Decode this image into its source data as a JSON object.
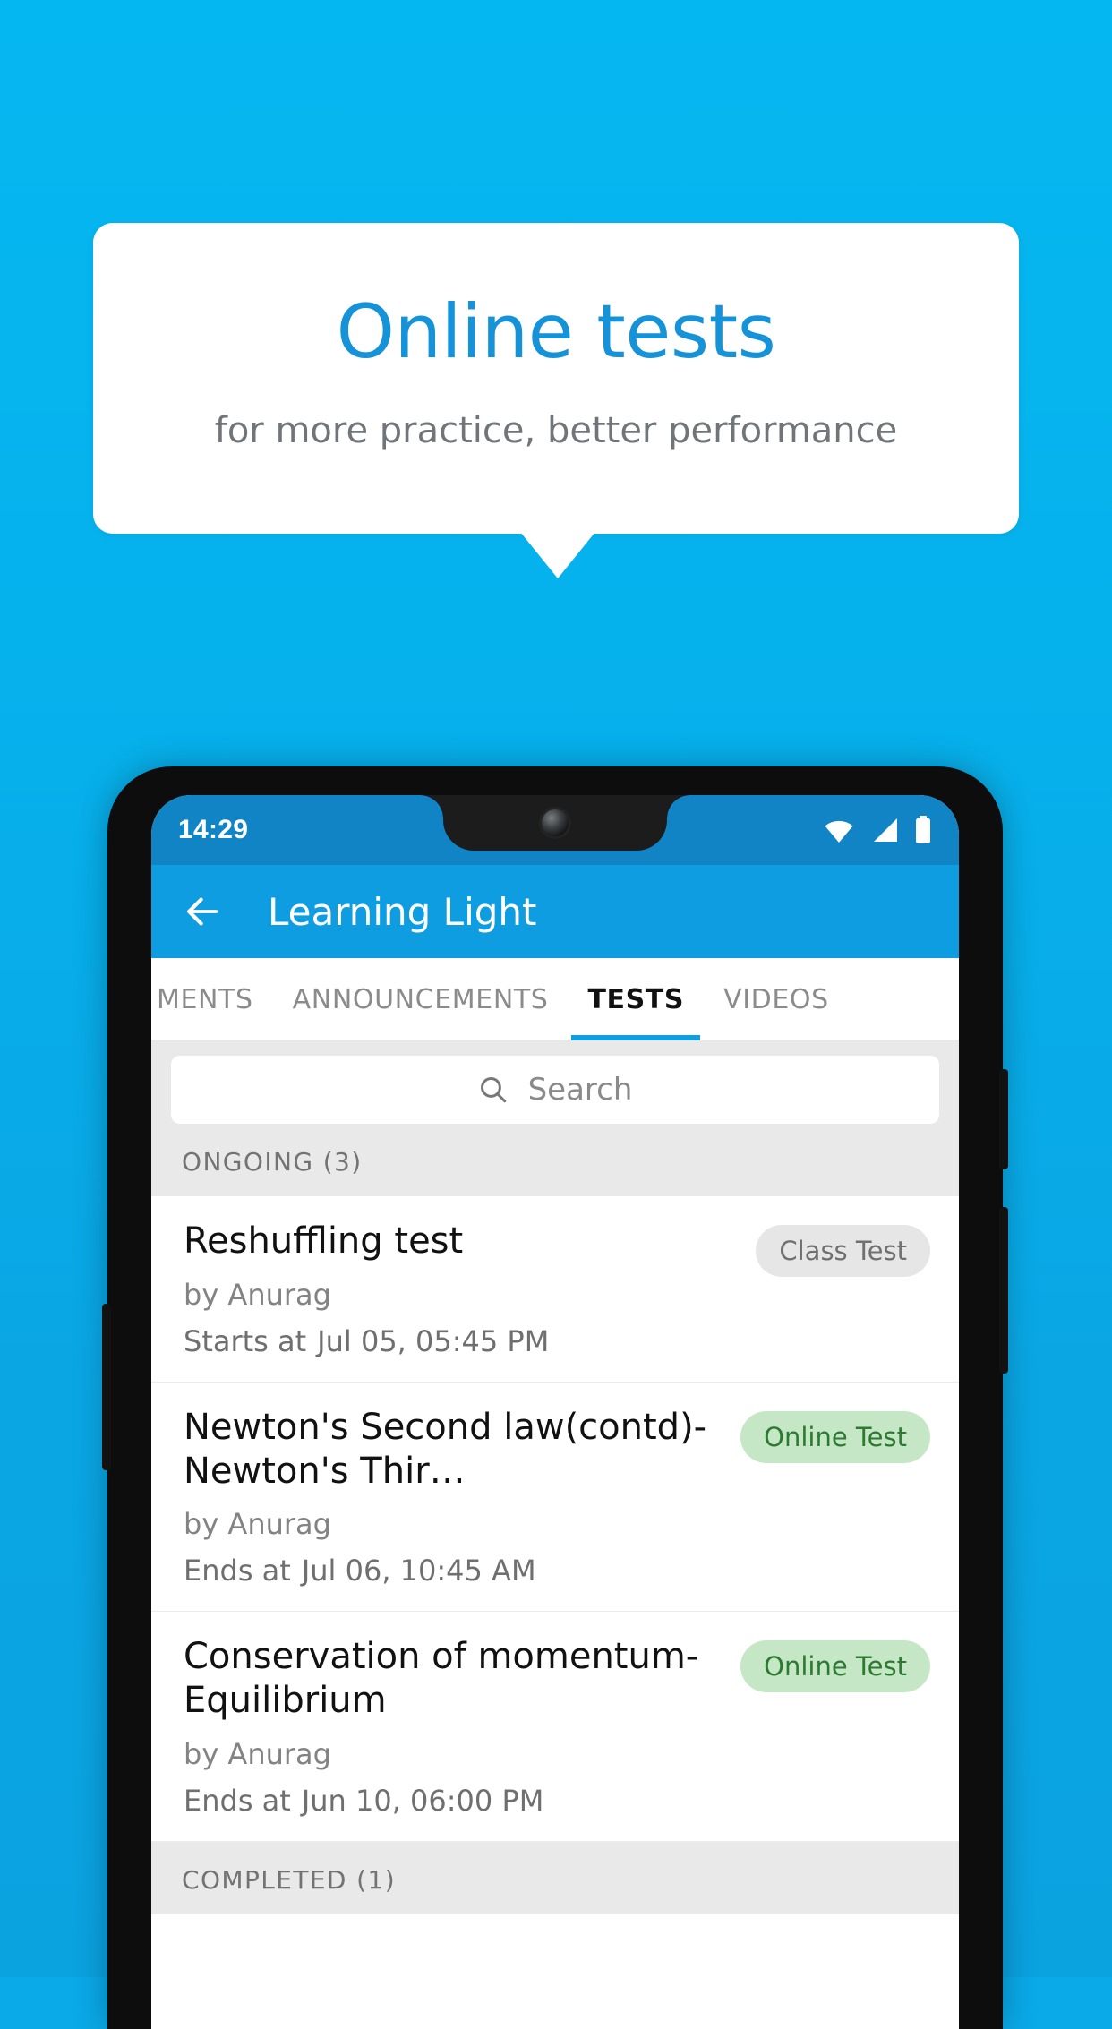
{
  "promo": {
    "title": "Online tests",
    "subtitle": "for more practice, better performance",
    "bg_color": "#06b1ec",
    "title_color": "#1592d8"
  },
  "phone": {
    "statusbar": {
      "time": "14:29",
      "icons": [
        "wifi-icon",
        "signal-icon",
        "battery-icon"
      ]
    },
    "appbar": {
      "back_icon": "back-arrow-icon",
      "title": "Learning Light",
      "bg_color": "#0d9de0"
    },
    "tabs": [
      {
        "label": "MENTS",
        "active": false,
        "partial": true
      },
      {
        "label": "ANNOUNCEMENTS",
        "active": false,
        "partial": false
      },
      {
        "label": "TESTS",
        "active": true,
        "partial": false
      },
      {
        "label": "VIDEOS",
        "active": false,
        "partial": false
      }
    ],
    "search": {
      "icon": "search-icon",
      "placeholder": "Search",
      "value": ""
    },
    "sections": [
      {
        "header": "ONGOING (3)",
        "items": [
          {
            "title": "Reshuffling test",
            "author": "by Anurag",
            "time_label": "Starts at",
            "time_value": "Jul 05, 05:45 PM",
            "badge": "Class Test",
            "badge_type": "gray"
          },
          {
            "title": "Newton's Second law(contd)-Newton's Thir…",
            "author": "by Anurag",
            "time_label": "Ends at",
            "time_value": "Jul 06, 10:45 AM",
            "badge": "Online Test",
            "badge_type": "green"
          },
          {
            "title": "Conservation of momentum-Equilibrium",
            "author": "by Anurag",
            "time_label": "Ends at",
            "time_value": "Jun 10, 06:00 PM",
            "badge": "Online Test",
            "badge_type": "green"
          }
        ]
      },
      {
        "header": "COMPLETED (1)",
        "items": []
      }
    ]
  }
}
